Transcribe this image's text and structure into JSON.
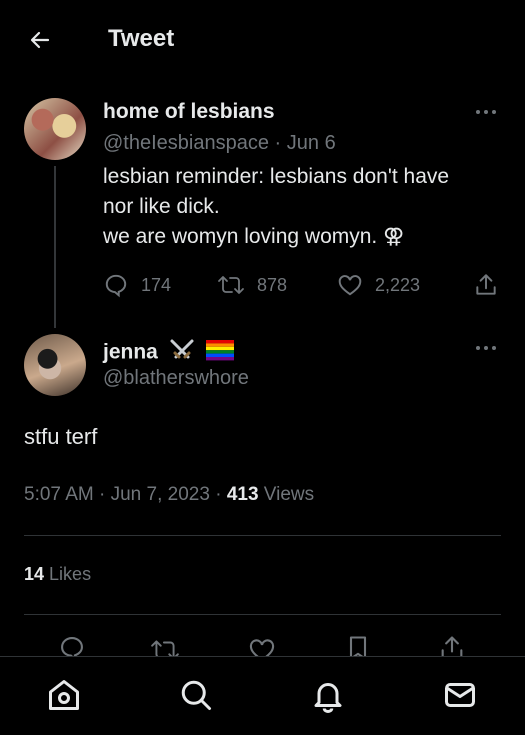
{
  "header": {
    "title": "Tweet",
    "back_icon": "arrow-left-icon"
  },
  "original_tweet": {
    "name": "home of lesbians",
    "handle": "@theIesbianspace",
    "date": "Jun 6",
    "separator": "·",
    "text_lines": [
      "lesbian reminder: lesbians don't have",
      "nor like dick.",
      "we are womyn loving womyn. ⚢"
    ],
    "stats": {
      "replies": "174",
      "retweets": "878",
      "likes": "2,223"
    }
  },
  "reply_tweet": {
    "name": "jenna",
    "name_emojis": [
      "crossed-swords-emoji",
      "rainbow-flag-emoji"
    ],
    "handle": "@blatherswhore",
    "text": "stfu terf",
    "time": "5:07 AM",
    "date": "Jun 7, 2023",
    "views_count": "413",
    "views_label": "Views",
    "likes_count": "14",
    "likes_label": "Likes"
  },
  "bottom_nav": [
    "home-icon",
    "search-icon",
    "notifications-icon",
    "messages-icon"
  ],
  "colors": {
    "background": "#000000",
    "text": "#e7e9ea",
    "muted": "#71767b",
    "divider": "#2f3336"
  }
}
